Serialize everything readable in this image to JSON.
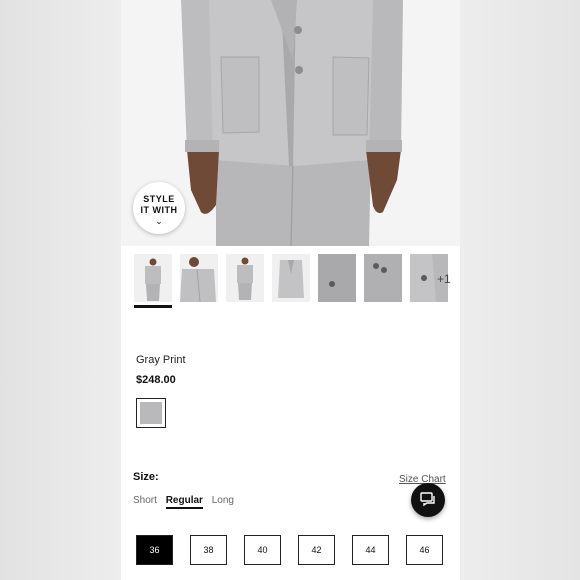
{
  "hero": {
    "style_badge": {
      "line1": "STYLE",
      "line2": "IT WITH",
      "icon": "chevron-down-icon"
    }
  },
  "thumbnails": {
    "count_visible": 7,
    "more_label": "+1",
    "active_index": 0
  },
  "product": {
    "name": "Gray Print",
    "price": "$248.00",
    "swatch_color": "#b9b9bb"
  },
  "size": {
    "label": "Size:",
    "chart_link": "Size Chart",
    "fits": [
      "Short",
      "Regular",
      "Long"
    ],
    "selected_fit": "Regular",
    "options": [
      "36",
      "38",
      "40",
      "42",
      "44",
      "46"
    ],
    "selected_option": "36"
  },
  "chat": {
    "icon": "chat-bubble-icon"
  }
}
